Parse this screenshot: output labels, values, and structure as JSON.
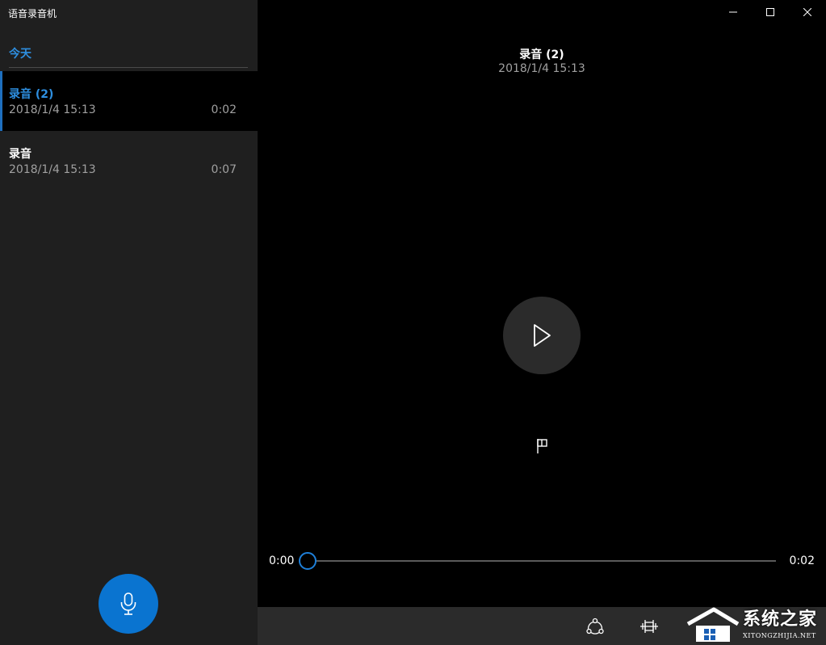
{
  "app": {
    "title": "语音录音机"
  },
  "sidebar": {
    "group_header": "今天",
    "recordings": [
      {
        "name": "录音 (2)",
        "date": "2018/1/4 15:13",
        "duration": "0:02",
        "selected": true
      },
      {
        "name": "录音",
        "date": "2018/1/4 15:13",
        "duration": "0:07",
        "selected": false
      }
    ],
    "record_button_icon": "microphone-icon"
  },
  "player": {
    "title": "录音 (2)",
    "date": "2018/1/4 15:13",
    "current_time": "0:00",
    "total_time": "0:02",
    "progress": 0,
    "play_icon": "play-icon",
    "marker_icon": "flag-icon"
  },
  "commands": [
    {
      "name": "share-icon"
    },
    {
      "name": "trim-icon"
    }
  ],
  "watermark": {
    "text_cn": "系统之家",
    "text_en": "XITONGZHIJIA.NET"
  },
  "colors": {
    "accent": "#0a74d0",
    "accent_text": "#2e8fe0",
    "sidebar_bg": "#1f1f1f",
    "main_bg": "#000000",
    "command_bar_bg": "#2b2b2b"
  }
}
